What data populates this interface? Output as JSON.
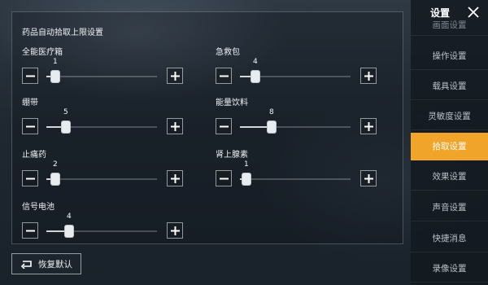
{
  "panel": {
    "section_title": "药品自动拾取上限设置",
    "items": [
      {
        "label": "全能医疗箱",
        "value": "1",
        "level": 0.05
      },
      {
        "label": "急救包",
        "value": "4",
        "level": 0.11
      },
      {
        "label": "绷带",
        "value": "5",
        "level": 0.15
      },
      {
        "label": "能量饮料",
        "value": "8",
        "level": 0.26
      },
      {
        "label": "止痛药",
        "value": "2",
        "level": 0.05
      },
      {
        "label": "肾上腺素",
        "value": "1",
        "level": 0.03
      },
      {
        "label": "信号电池",
        "value": "4",
        "level": 0.18
      }
    ]
  },
  "reset_label": "恢复默认",
  "sidebar": {
    "title": "设置",
    "items": [
      {
        "label": "画面设置",
        "active": false
      },
      {
        "label": "操作设置",
        "active": false
      },
      {
        "label": "载具设置",
        "active": false
      },
      {
        "label": "灵敏度设置",
        "active": false
      },
      {
        "label": "拾取设置",
        "active": true
      },
      {
        "label": "效果设置",
        "active": false
      },
      {
        "label": "声音设置",
        "active": false
      },
      {
        "label": "快捷消息",
        "active": false
      },
      {
        "label": "录像设置",
        "active": false
      }
    ]
  },
  "colors": {
    "accent": "#f0a52a"
  },
  "icons": {
    "close": "close-icon",
    "reset": "reset-icon",
    "minus": "minus-icon",
    "plus": "plus-icon"
  }
}
